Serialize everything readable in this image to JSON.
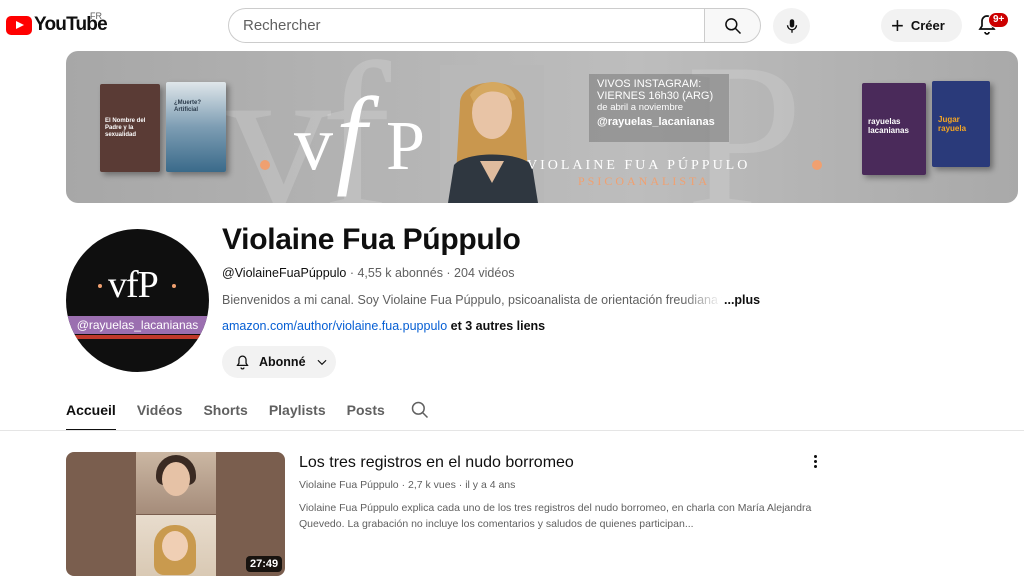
{
  "header": {
    "logo_text": "YouTube",
    "country_code": "FR",
    "search_placeholder": "Rechercher",
    "create_label": "Créer",
    "notifications_badge": "9+"
  },
  "banner": {
    "instagram_line1": "VIVOS INSTAGRAM:",
    "instagram_line2": "VIERNES 16h30 (ARG)",
    "instagram_line3": "de abril a noviembre",
    "instagram_handle": "@rayuelas_lacanianas",
    "logo_letters": "vfP",
    "name": "VIOLAINE FUA PÚPPULO",
    "role": "PSICOANALISTA",
    "books": [
      {
        "title": "El Nombre del Padre y la sexualidad",
        "color": "#5a3b35"
      },
      {
        "title": "¿Muerte? Artificial",
        "color": "#3a6a8a"
      },
      {
        "title": "rayuelas lacanianas",
        "color": "#4a2a5a"
      },
      {
        "title": "Jugar rayuela",
        "color": "#2a3a7a"
      }
    ]
  },
  "channel": {
    "name": "Violaine Fua Púppulo",
    "handle": "@ViolaineFuaPúppulo",
    "stats": " · 4,55 k abonnés · 204 vidéos",
    "description": "Bienvenidos a mi canal. Soy Violaine Fua Púppulo, psicoanalista de orientación freudiana y",
    "more": "...plus",
    "link": "amazon.com/author/violaine.fua.puppulo",
    "more_links": " et 3 autres liens",
    "subscribe_label": "Abonné",
    "avatar_letters": "vfP",
    "avatar_handle": "@rayuelas_lacanianas"
  },
  "tabs": [
    {
      "label": "Accueil",
      "active": true
    },
    {
      "label": "Vidéos",
      "active": false
    },
    {
      "label": "Shorts",
      "active": false
    },
    {
      "label": "Playlists",
      "active": false
    },
    {
      "label": "Posts",
      "active": false
    }
  ],
  "video": {
    "title": "Los tres registros en el nudo borromeo",
    "channel": "Violaine Fua Púppulo",
    "views": "2,7 k vues",
    "age": "il y a 4 ans",
    "description": "Violaine Fua Púppulo explica cada uno de los tres registros del nudo borromeo, en charla con María Alejandra Quevedo. La grabación no incluye los comentarios y saludos de quienes participan...",
    "duration": "27:49"
  },
  "colors": {
    "brand_red": "#ff0000",
    "link_blue": "#065fd4",
    "accent_orange": "#f0a070",
    "badge_red": "#cc0000"
  }
}
